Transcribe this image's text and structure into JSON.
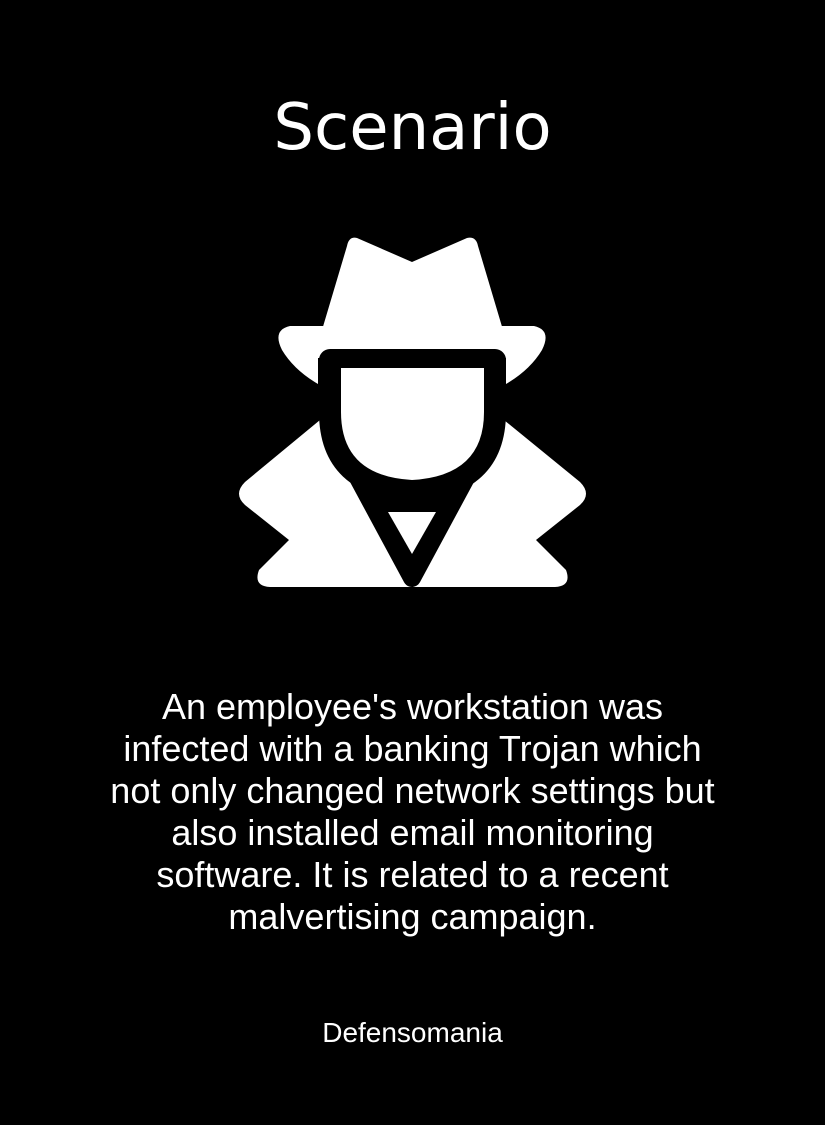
{
  "card": {
    "title": "Scenario",
    "icon": "spy-icon",
    "description": "An employee's workstation was infected with a banking Trojan which not only changed network settings but also installed email monitoring software. It is related to a recent malvertising campaign.",
    "footer": "Defensomania"
  },
  "colors": {
    "background": "#000000",
    "foreground": "#ffffff"
  }
}
